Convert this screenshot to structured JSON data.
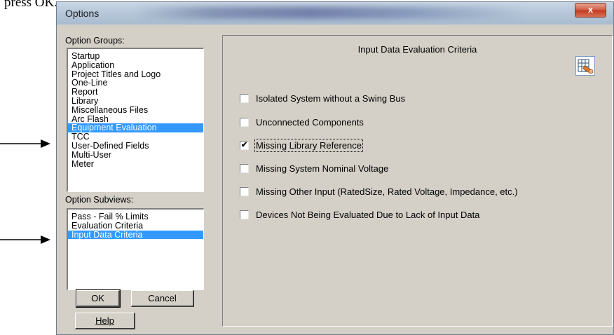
{
  "document": {
    "leading_text": "press OK."
  },
  "window": {
    "title": "Options",
    "close_label": "x"
  },
  "option_groups": {
    "label": "Option Groups:",
    "items": [
      "Startup",
      "Application",
      "Project Titles and Logo",
      "One-Line",
      "Report",
      "Library",
      "Miscellaneous Files",
      "Arc Flash",
      "Equipment Evaluation",
      "TCC",
      "User-Defined Fields",
      "Multi-User",
      "Meter"
    ],
    "selected_index": 8
  },
  "option_subviews": {
    "label": "Option Subviews:",
    "items": [
      "Pass - Fail % Limits",
      "Evaluation Criteria",
      "Input Data Criteria"
    ],
    "selected_index": 2
  },
  "buttons": {
    "ok": "OK",
    "cancel": "Cancel",
    "help": "Help"
  },
  "panel": {
    "title": "Input Data Evaluation Criteria",
    "icon": "data-tool-icon",
    "checkboxes": [
      {
        "label": "Isolated System without a Swing Bus",
        "checked": false
      },
      {
        "label": "Unconnected Components",
        "checked": false
      },
      {
        "label": "Missing Library Reference",
        "checked": true
      },
      {
        "label": "Missing System Nominal Voltage",
        "checked": false
      },
      {
        "label": "Missing Other Input (RatedSize, Rated Voltage, Impedance,  etc.)",
        "checked": false
      },
      {
        "label": "Devices Not Being Evaluated Due to Lack of Input Data",
        "checked": false
      }
    ]
  },
  "colors": {
    "selection": "#3399ff",
    "dialog_bg": "#d4d0c8",
    "close_button": "#c8452b"
  }
}
